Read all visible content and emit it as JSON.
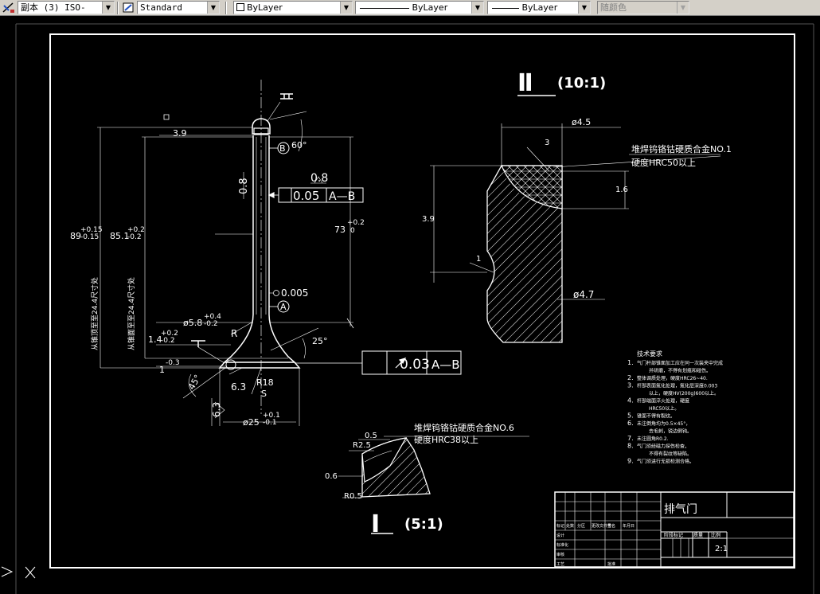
{
  "toolbar": {
    "dimstyle": "副本 (3) ISO-",
    "textstyle": "Standard",
    "layer": "ByLayer",
    "linetype": "ByLayer",
    "lineweight": "ByLayer",
    "plotstyle": "随颜色"
  },
  "drawing": {
    "detail2_label": "Ⅱ",
    "detail2_scale": "(10:1)",
    "detail1_label": "Ⅰ",
    "detail1_scale": "(5:1)",
    "dims": {
      "d39": "3.9",
      "angle60": "60°",
      "t08a": "0.8",
      "t08b": "0.8",
      "tol005": "0.05",
      "tolAB": "A—B",
      "dim73": "73",
      "dim73_up": "+0.2",
      "dim73_lo": "0",
      "dim89": "89",
      "dim89_up": "+0.15",
      "dim89_lo": "-0.15",
      "dim851": "85.1",
      "dim851_up": "+0.2",
      "dim851_lo": "-0.2",
      "len1": "从锥顶至至24.4尺寸处",
      "len2": "从锥面至至24.4尺寸处",
      "circ005": "0.005",
      "dA": "A",
      "dB": "B",
      "dia58": "ø5.8",
      "dia58_up": "+0.4",
      "dia58_lo": "-0.2",
      "d14": "1.4",
      "d14_up": "+0.2",
      "d14_lo": "-0.2",
      "d1": "1",
      "d1_lo": "-0.3",
      "r": "R",
      "ang25": "25°",
      "ang45": "45°",
      "d63a": "6.3",
      "d63b": "6.3",
      "r18": "R18",
      "s": "S",
      "d25": "ø25",
      "d25_up": "+0.1",
      "d25_lo": "-0.1",
      "sym1": "I",
      "sym2": "II",
      "runout": "0.03",
      "runoutAB": "A—B",
      "d45": "ø4.5",
      "note1": "堆焊钨铬钴硬质合金NO.1",
      "note1b": "硬度HRC50以上",
      "d16": "1.6",
      "d39b": "3.9",
      "d47": "ø4.7",
      "n3": "3",
      "n1": "1",
      "note2": "堆焊钨铬钴硬质合金NO.6",
      "note2b": "硬度HRC38以上",
      "d05": "0.5",
      "r25": "R2.5",
      "d06": "0.6",
      "r05": "R0.5"
    },
    "notes_title": "技术要求",
    "notes": [
      {
        "n": "1.",
        "t": "气门杆部锥面加工应在同一次装夹中完成"
      },
      {
        "n": "",
        "t": "并研磨，不得有划痕和碰伤。"
      },
      {
        "n": "2.",
        "t": "整体调质处理，硬度HRC26~40."
      },
      {
        "n": "3.",
        "t": "杆部表面氮化处理，氮化层深度0.003"
      },
      {
        "n": "",
        "t": "以上，硬度HV(200g)600以上。"
      },
      {
        "n": "4.",
        "t": "杆部端面淬火处理，硬度"
      },
      {
        "n": "",
        "t": "HRC50以上。"
      },
      {
        "n": "5.",
        "t": "锥面不得有裂纹。"
      },
      {
        "n": "6.",
        "t": "未注倒角均为0.5×45°，"
      },
      {
        "n": "",
        "t": "去毛刺，锐边倒钝。"
      },
      {
        "n": "7.",
        "t": "未注圆角R0.2."
      },
      {
        "n": "8.",
        "t": "气门须经磁力探伤检查，"
      },
      {
        "n": "",
        "t": "不得有裂纹等缺陷。"
      },
      {
        "n": "9.",
        "t": "气门须进行无损检测合格。"
      }
    ],
    "title_block": {
      "name": "排气门",
      "scale": "2:1",
      "weight_label": "质量",
      "scale_label": "比例",
      "stage_label": "阶段标记",
      "row1": [
        "标记",
        "处数",
        "分区",
        "更改文件号",
        "签名",
        "年月日"
      ],
      "designer": "设计",
      "checker": "审核",
      "approver": "批准",
      "standard": "标准化",
      "process": "工艺"
    }
  }
}
